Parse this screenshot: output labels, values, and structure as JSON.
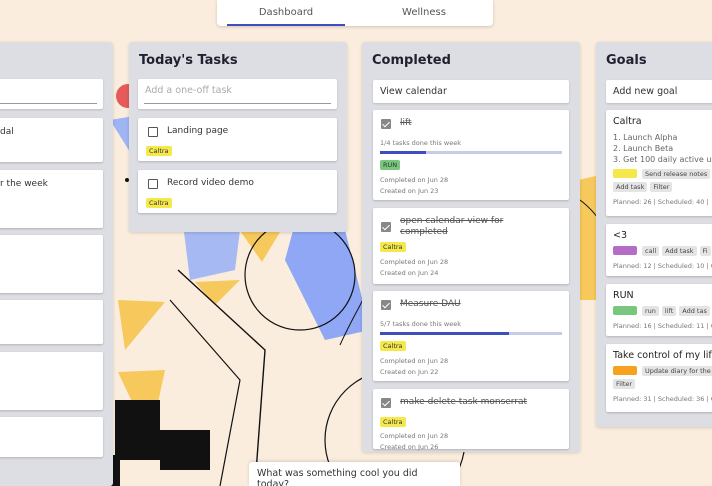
{
  "nav": {
    "tabs": [
      {
        "label": "Dashboard",
        "active": true
      },
      {
        "label": "Wellness",
        "active": false
      }
    ]
  },
  "left_column": {
    "items": [
      {
        "text": ""
      },
      {
        "text": "dal"
      },
      {
        "text": "r the week"
      }
    ]
  },
  "today": {
    "title": "Today's Tasks",
    "add_placeholder": "Add a one-off task",
    "tasks": [
      {
        "label": "Landing page",
        "tag": "Caltra"
      },
      {
        "label": "Record video demo",
        "tag": "Caltra"
      }
    ]
  },
  "completed": {
    "title": "Completed",
    "view_calendar": "View calendar",
    "tasks": [
      {
        "label": "lift",
        "progress_text": "1/4 tasks done this week",
        "progress": 0.25,
        "tag": "RUN",
        "completed": "Completed on Jun 28",
        "created": "Created on Jun 23"
      },
      {
        "label": "open calendar view for completed",
        "tag": "Caltra",
        "completed": "Completed on Jun 28",
        "created": "Created on Jun 24"
      },
      {
        "label": "Measure DAU",
        "progress_text": "5/7 tasks done this week",
        "progress": 0.71,
        "tag": "Caltra",
        "completed": "Completed on Jun 28",
        "created": "Created on Jun 22"
      },
      {
        "label": "make delete task monserrat",
        "tag": "Caltra",
        "completed": "Completed on Jun 28",
        "created": "Created on Jun 26"
      }
    ]
  },
  "goals": {
    "title": "Goals",
    "add_label": "Add new goal",
    "items": [
      {
        "title": "Caltra",
        "lines": [
          "1. Launch Alpha",
          "2. Launch Beta",
          "3. Get 100 daily active use"
        ],
        "color": "#f4e84a",
        "chips": [
          "Send release notes",
          "Add task",
          "Filter"
        ],
        "planned": "Planned: 26 | Scheduled: 40 |"
      },
      {
        "title": "<3",
        "color": "#b46cc7",
        "chips": [
          "call",
          "Add task",
          "Fi"
        ],
        "planned": "Planned: 12 | Scheduled: 10 | C"
      },
      {
        "title": "RUN",
        "color": "#79c77d",
        "chips": [
          "run",
          "lift",
          "Add tas"
        ],
        "planned": "Planned: 16 | Scheduled: 11 | C"
      },
      {
        "title": "Take control of my life",
        "color": "#f6a21e",
        "chips": [
          "Update diary for the",
          "Filter"
        ],
        "planned": "Planned: 31 | Scheduled: 36 | C"
      }
    ]
  },
  "prompt": {
    "text": "What was something cool you did today?"
  }
}
